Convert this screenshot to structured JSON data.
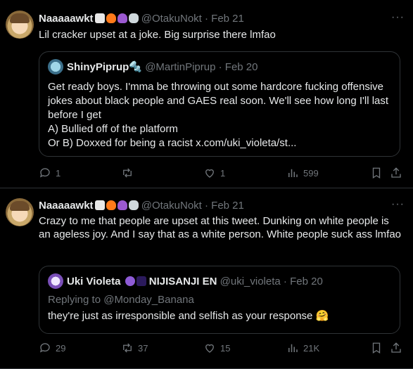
{
  "tweets": [
    {
      "author": "Naaaaawkt",
      "handle": "@OtakuNokt",
      "dot": "·",
      "date": "Feb 21",
      "text": "Lil cracker upset at a joke. Big surprise there lmfao",
      "quote": {
        "author": "ShinyPiprup🔩",
        "handle": "@MartinPiprup",
        "date": "Feb 20",
        "text": "Get ready boys. I'mma be throwing out some hardcore fucking offensive jokes about black people and GAES real soon. We'll see how long I'll last before I get\nA) Bullied off of the platform\nOr B) Doxxed for being a racist x.com/uki_violeta/st..."
      },
      "stats": {
        "replies": "1",
        "reposts": "",
        "likes": "1",
        "views": "599"
      }
    },
    {
      "author": "Naaaaawkt",
      "handle": "@OtakuNokt",
      "dot": "·",
      "date": "Feb 21",
      "text": "Crazy to me that people are upset at this tweet. Dunking on white people is an ageless joy. And I say that as a white person. White people suck ass lmfao",
      "quote": {
        "author": "Uki Violeta",
        "name_suffix": "NIJISANJI EN",
        "handle": "@uki_violeta",
        "date": "Feb 20",
        "replying_to": "Replying to @Monday_Banana",
        "text": "they're just as irresponsible and selfish as your response 🤗"
      },
      "stats": {
        "replies": "29",
        "reposts": "37",
        "likes": "15",
        "views": "21K"
      }
    }
  ],
  "more_label": "···",
  "icons": [
    "reply-icon",
    "repost-icon",
    "like-icon",
    "views-icon",
    "bookmark-icon",
    "share-icon"
  ],
  "colors": {
    "background": "#000000",
    "text": "#e7e9ea",
    "muted": "#71767b",
    "border": "#2f3336"
  }
}
